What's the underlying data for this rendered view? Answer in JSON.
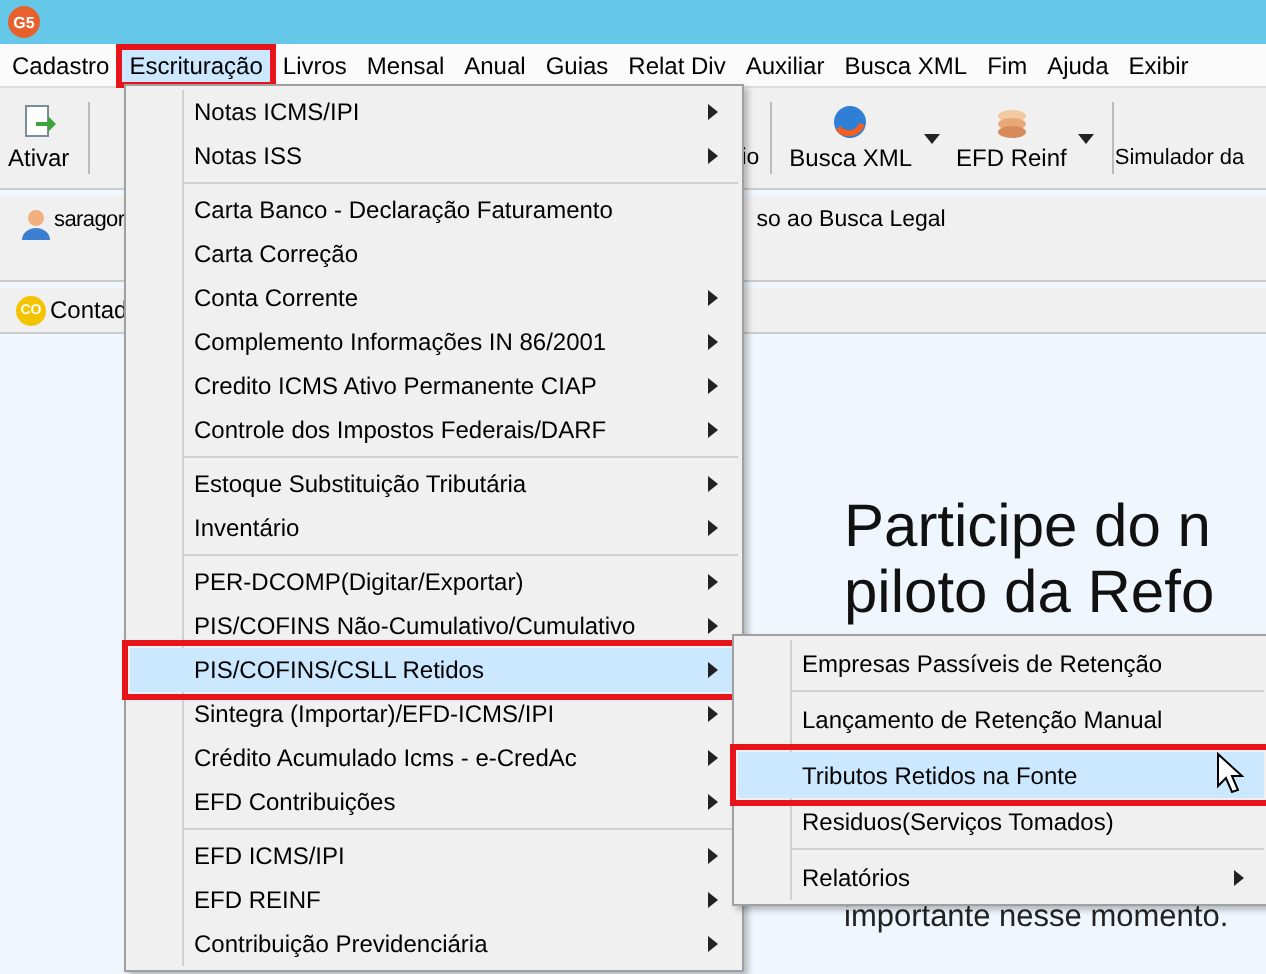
{
  "window": {
    "app_badge": "G5"
  },
  "menu_bar": [
    {
      "label": "Cadastro",
      "selected": false
    },
    {
      "label": "Escrituração",
      "selected": true
    },
    {
      "label": "Livros",
      "selected": false
    },
    {
      "label": "Mensal",
      "selected": false
    },
    {
      "label": "Anual",
      "selected": false
    },
    {
      "label": "Guias",
      "selected": false
    },
    {
      "label": "Relat Div",
      "selected": false
    },
    {
      "label": "Auxiliar",
      "selected": false
    },
    {
      "label": "Busca XML",
      "selected": false
    },
    {
      "label": "Fim",
      "selected": false
    },
    {
      "label": "Ajuda",
      "selected": false
    },
    {
      "label": "Exibir",
      "selected": false
    }
  ],
  "toolbar": [
    {
      "kind": "ativar",
      "label": "Ativar"
    },
    {
      "kind": "partial",
      "label": "io"
    },
    {
      "kind": "xml",
      "label": "Busca XML",
      "dropdown": true
    },
    {
      "kind": "reinf",
      "label": "EFD Reinf",
      "dropdown": true
    },
    {
      "kind": "text",
      "label": "Simulador da"
    }
  ],
  "user_bar": {
    "user": "saragor",
    "link": "so ao Busca Legal"
  },
  "tabs": [
    {
      "label": "Contad",
      "badge": "CO"
    }
  ],
  "content": {
    "headline": [
      "Participe do n",
      "piloto da Refo"
    ],
    "body": "importante nesse momento."
  },
  "dropdown": {
    "groups": [
      [
        {
          "label": "Notas ICMS/IPI",
          "submenu": true,
          "selected": false
        },
        {
          "label": "Notas ISS",
          "submenu": true,
          "selected": false
        }
      ],
      [
        {
          "label": "Carta Banco - Declaração Faturamento",
          "submenu": false,
          "selected": false
        },
        {
          "label": "Carta Correção",
          "submenu": false,
          "selected": false
        },
        {
          "label": "Conta Corrente",
          "submenu": true,
          "selected": false
        },
        {
          "label": "Complemento Informações IN 86/2001",
          "submenu": true,
          "selected": false
        },
        {
          "label": "Credito ICMS Ativo Permanente CIAP",
          "submenu": true,
          "selected": false
        },
        {
          "label": "Controle dos Impostos Federais/DARF",
          "submenu": true,
          "selected": false
        }
      ],
      [
        {
          "label": "Estoque Substituição Tributária",
          "submenu": true,
          "selected": false
        },
        {
          "label": "Inventário",
          "submenu": true,
          "selected": false
        }
      ],
      [
        {
          "label": "PER-DCOMP(Digitar/Exportar)",
          "submenu": true,
          "selected": false
        },
        {
          "label": "PIS/COFINS Não-Cumulativo/Cumulativo",
          "submenu": true,
          "selected": false
        },
        {
          "label": "PIS/COFINS/CSLL Retidos",
          "submenu": true,
          "selected": true
        },
        {
          "label": "Sintegra (Importar)/EFD-ICMS/IPI",
          "submenu": true,
          "selected": false
        },
        {
          "label": "Crédito Acumulado Icms - e-CredAc",
          "submenu": true,
          "selected": false
        },
        {
          "label": "EFD Contribuições",
          "submenu": true,
          "selected": false
        }
      ],
      [
        {
          "label": "EFD ICMS/IPI",
          "submenu": true,
          "selected": false
        },
        {
          "label": "EFD REINF",
          "submenu": true,
          "selected": false
        },
        {
          "label": "Contribuição Previdenciária",
          "submenu": true,
          "selected": false
        }
      ]
    ]
  },
  "submenu": {
    "groups": [
      [
        {
          "label": "Empresas Passíveis de Retenção",
          "submenu": false,
          "selected": false
        }
      ],
      [
        {
          "label": "Lançamento de Retenção Manual",
          "submenu": false,
          "selected": false
        }
      ],
      [
        {
          "label": "Tributos Retidos na Fonte",
          "submenu": false,
          "selected": true
        },
        {
          "label": "Residuos(Serviços Tomados)",
          "submenu": false,
          "selected": false
        }
      ],
      [
        {
          "label": "Relatórios",
          "submenu": true,
          "selected": false
        }
      ]
    ]
  }
}
